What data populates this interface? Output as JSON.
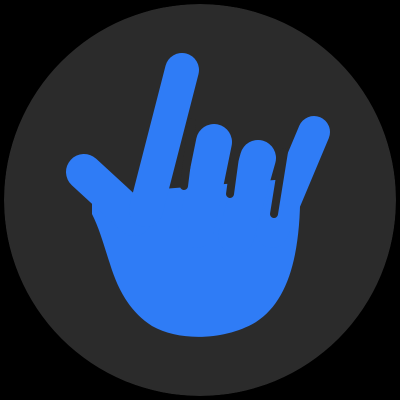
{
  "icon": {
    "name": "love-you-hand-sign-icon",
    "colors": {
      "page_background": "#000000",
      "circle_background": "#2B2B2B",
      "hand_fill": "#2F7CF6",
      "finger_gap_color": "#2B2B2B"
    }
  }
}
